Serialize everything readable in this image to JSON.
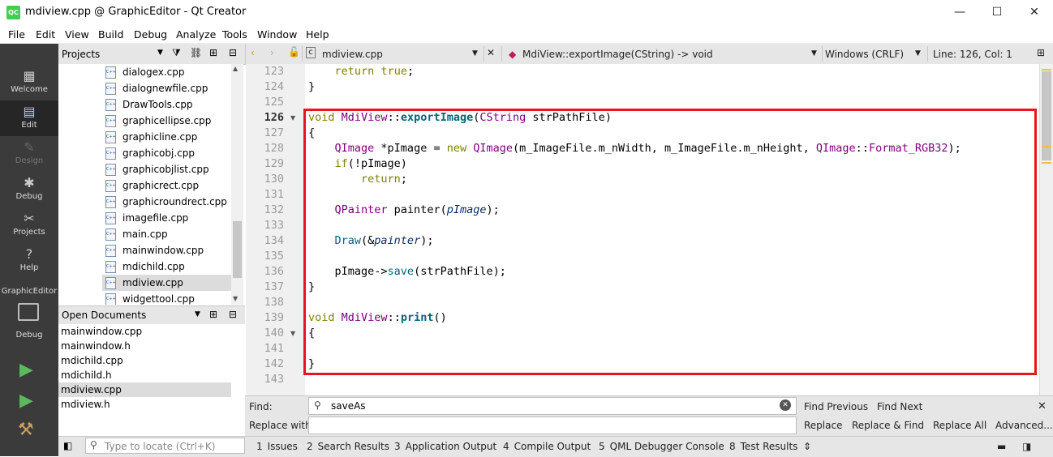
{
  "window": {
    "title": "mdiview.cpp @ GraphicEditor - Qt Creator",
    "app_icon": "QC",
    "minimize": "—",
    "maximize": "☐",
    "close": "✕"
  },
  "menu": [
    "File",
    "Edit",
    "View",
    "Build",
    "Debug",
    "Analyze",
    "Tools",
    "Window",
    "Help"
  ],
  "modes": [
    {
      "label": "Welcome",
      "icon": "grid-icon"
    },
    {
      "label": "Edit",
      "icon": "document-icon"
    },
    {
      "label": "Design",
      "icon": "pen-icon"
    },
    {
      "label": "Debug",
      "icon": "bug-icon"
    },
    {
      "label": "Projects",
      "icon": "wrench-icon"
    },
    {
      "label": "Help",
      "icon": "help-icon"
    }
  ],
  "kit": {
    "project": "GraphicEditor",
    "build": "Debug"
  },
  "projects_pane": {
    "title": "Projects",
    "files": [
      "dialogex.cpp",
      "dialognewfile.cpp",
      "DrawTools.cpp",
      "graphicellipse.cpp",
      "graphicline.cpp",
      "graphicobj.cpp",
      "graphicobjlist.cpp",
      "graphicrect.cpp",
      "graphicroundrect.cpp",
      "imagefile.cpp",
      "main.cpp",
      "mainwindow.cpp",
      "mdichild.cpp",
      "mdiview.cpp",
      "widgettool.cpp"
    ],
    "selected_file": "mdiview.cpp",
    "cpp_icon_text": "C++"
  },
  "open_documents": {
    "title": "Open Documents",
    "files": [
      "mainwindow.cpp",
      "mainwindow.h",
      "mdichild.cpp",
      "mdichild.h",
      "mdiview.cpp",
      "mdiview.h"
    ],
    "selected": "mdiview.cpp"
  },
  "locator": {
    "placeholder": "Type to locate (Ctrl+K)"
  },
  "editor_toolbar": {
    "file": "mdiview.cpp",
    "symbol": "MdiView::exportImage(CString) -> void",
    "line_ending": "Windows (CRLF)",
    "position": "Line: 126, Col: 1"
  },
  "editor": {
    "current_line": 126,
    "line_numbers": [
      123,
      124,
      125,
      126,
      127,
      128,
      129,
      130,
      131,
      132,
      133,
      134,
      135,
      136,
      137,
      138,
      139,
      140,
      141,
      142,
      143
    ],
    "code_text": {
      "l123_a": "    ",
      "l123_kw": "return",
      "l123_b": " ",
      "l123_kw2": "true",
      "l123_c": ";",
      "l124": "}",
      "l126_kw": "void",
      "l126_cls": "MdiView",
      "l126_sep": "::",
      "l126_fn": "exportImage",
      "l126_p1": "(",
      "l126_ty": "CString",
      "l126_arg": " strPathFile)",
      "l127": "{",
      "l128_ty": "QImage",
      "l128_a": " *pImage = ",
      "l128_kw": "new",
      "l128_sp": " ",
      "l128_ty2": "QImage",
      "l128_b": "(m_ImageFile.m_nWidth, m_ImageFile.m_nHeight, ",
      "l128_ty3": "QImage",
      "l128_sep": "::",
      "l128_en": "Format_RGB32",
      "l128_c": ");",
      "l129_kw": "if",
      "l129_a": "(!pImage)",
      "l130_kw": "return",
      "l130_a": ";",
      "l132_ty": "QPainter",
      "l132_a": " painter(",
      "l132_it": "pImage",
      "l132_b": ");",
      "l134_fn": "Draw",
      "l134_a": "(&",
      "l134_it": "painter",
      "l134_b": ");",
      "l136_a": "pImage->",
      "l136_fn": "save",
      "l136_b": "(strPathFile);",
      "l137": "}",
      "l139_kw": "void",
      "l139_cls": "MdiView",
      "l139_sep": "::",
      "l139_fn": "print",
      "l139_a": "()",
      "l140": "{",
      "l142": "}"
    }
  },
  "find": {
    "find_label": "Find:",
    "replace_label": "Replace with:",
    "find_value": "saveAs",
    "replace_value": "",
    "buttons": [
      "Find Previous",
      "Find Next",
      "Replace",
      "Replace & Find",
      "Replace All",
      "Advanced..."
    ]
  },
  "output_tabs": [
    {
      "num": "1",
      "label": "Issues"
    },
    {
      "num": "2",
      "label": "Search Results"
    },
    {
      "num": "3",
      "label": "Application Output"
    },
    {
      "num": "4",
      "label": "Compile Output"
    },
    {
      "num": "5",
      "label": "QML Debugger Console"
    },
    {
      "num": "8",
      "label": "Test Results"
    }
  ],
  "colors": {
    "highlight_box": "#e8141e",
    "keyword": "#808000",
    "type": "#800080",
    "function": "#00677c"
  }
}
